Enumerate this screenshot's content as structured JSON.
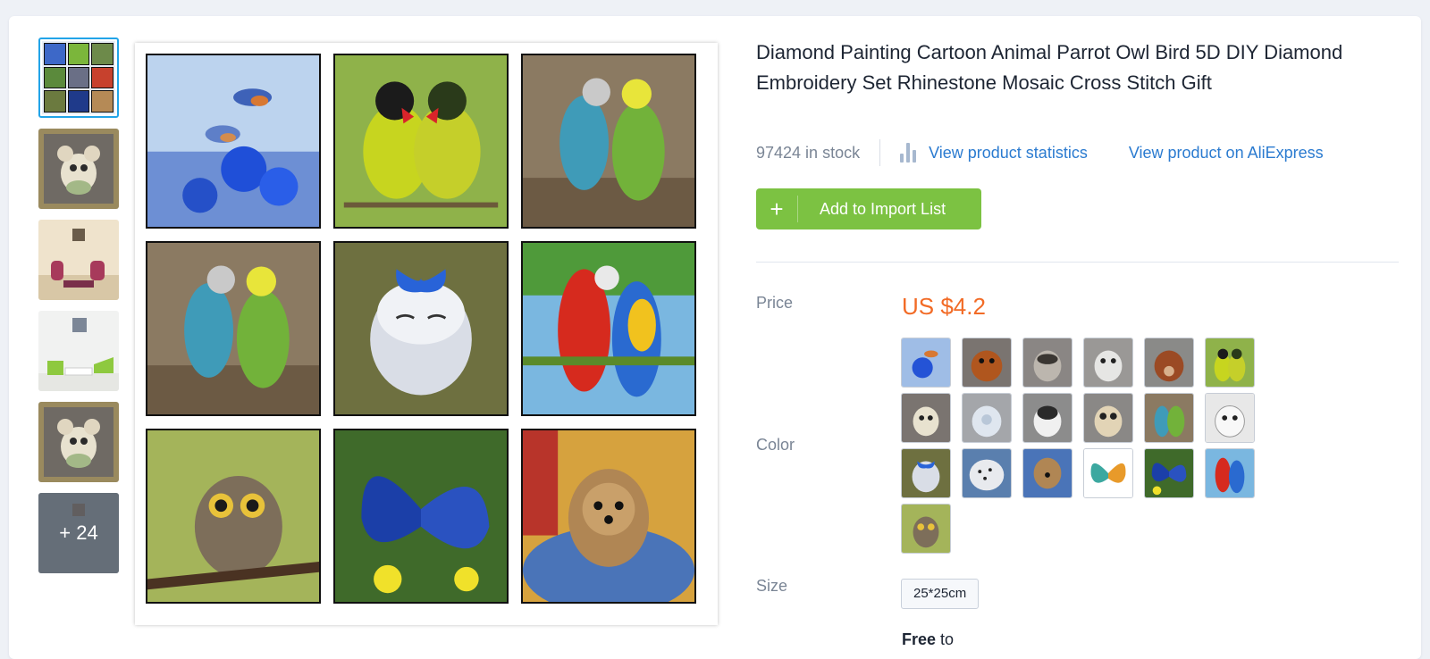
{
  "product": {
    "title": "Diamond Painting Cartoon Animal Parrot Owl Bird 5D DIY Diamond Embroidery Set Rhinestone Mosaic Cross Stitch Gift",
    "stock": "97424 in stock",
    "stats_link": "View product statistics",
    "ali_link": "View product on AliExpress",
    "add_button": "Add to Import List",
    "add_icon": "+"
  },
  "labels": {
    "price": "Price",
    "color": "Color",
    "size": "Size"
  },
  "price": "US $4.2",
  "size_option": "25*25cm",
  "shipping": {
    "free": "Free",
    "to": " to"
  },
  "gallery": {
    "more_count": "+ 24"
  },
  "colors": {
    "accent": "#7cc242",
    "link": "#2b7bd0",
    "price": "#f26b26"
  }
}
